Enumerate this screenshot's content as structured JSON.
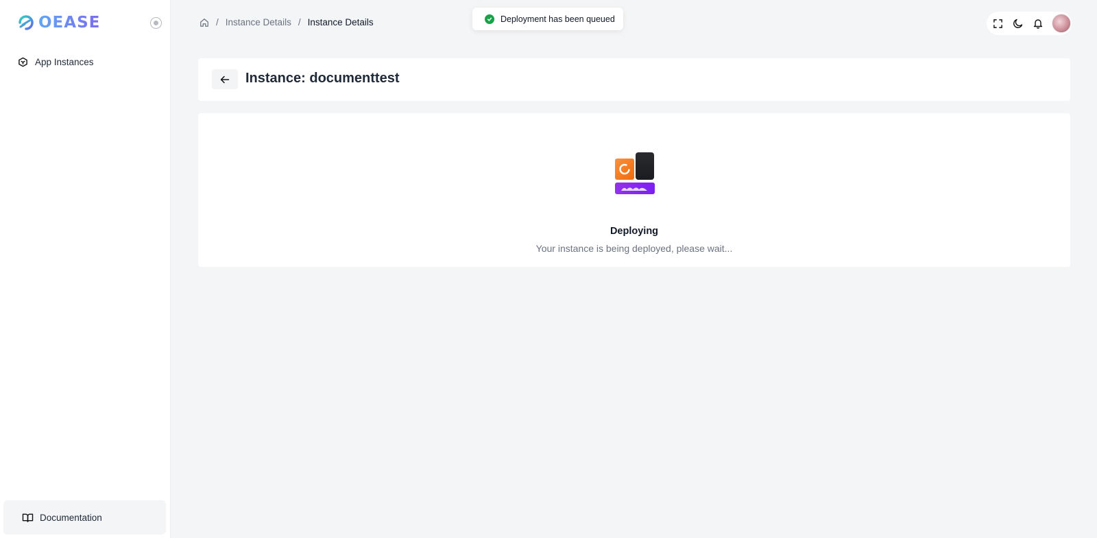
{
  "sidebar": {
    "logo_text": "OEASE",
    "nav_items": [
      {
        "label": "App Instances",
        "icon": "cube-icon"
      }
    ],
    "footer_item": {
      "label": "Documentation",
      "icon": "book-open-icon"
    }
  },
  "breadcrumb": {
    "items": [
      "Instance Details",
      "Instance Details"
    ],
    "separator": "/"
  },
  "toast": {
    "message": "Deployment has been queued",
    "status": "success",
    "color": "#16a34a"
  },
  "toolbar": {
    "icons": [
      "fullscreen-icon",
      "moon-icon",
      "bell-icon",
      "avatar"
    ]
  },
  "page": {
    "title": "Instance: documenttest"
  },
  "status": {
    "title": "Deploying",
    "message": "Your instance is being deployed, please wait..."
  },
  "colors": {
    "accent_orange": "#f97316",
    "accent_purple": "#8b2cf5",
    "dark": "#222326"
  }
}
